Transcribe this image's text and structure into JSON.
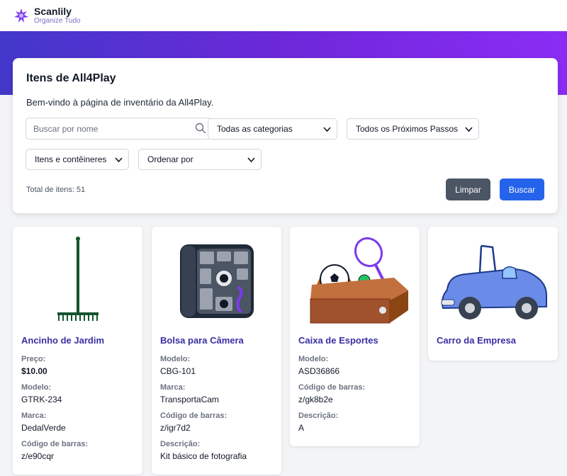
{
  "brand": {
    "name": "Scanlily",
    "tagline": "Organize Tudo"
  },
  "panel": {
    "title": "Itens de All4Play",
    "description": "Bem-vindo à página de inventário da All4Play.",
    "search_placeholder": "Buscar por nome",
    "filters": {
      "category": "Todas as categorias",
      "next_steps": "Todos os Próximos Passos",
      "item_type": "Itens e contêineres",
      "sort": "Ordenar por"
    },
    "total": "Total de itens: 51",
    "clear_label": "Limpar",
    "search_label": "Buscar"
  },
  "items": [
    {
      "title": "Ancinho de Jardim",
      "icon": "rake-icon",
      "fields": [
        {
          "label": "Preço:",
          "value": "$10.00"
        },
        {
          "label": "Modelo:",
          "value": "GTRK-234"
        },
        {
          "label": "Marca:",
          "value": "DedalVerde"
        },
        {
          "label": "Código de barras:",
          "value": "z/e90cqr"
        }
      ]
    },
    {
      "title": "Bolsa para Câmera",
      "icon": "camera-bag-icon",
      "fields": [
        {
          "label": "Modelo:",
          "value": "CBG-101"
        },
        {
          "label": "Marca:",
          "value": "TransportaCam"
        },
        {
          "label": "Código de barras:",
          "value": "z/igr7d2"
        },
        {
          "label": "Descrição:",
          "value": "Kit básico de fotografia"
        }
      ]
    },
    {
      "title": "Caixa de Esportes",
      "icon": "sports-box-icon",
      "fields": [
        {
          "label": "Modelo:",
          "value": "ASD36866"
        },
        {
          "label": "Código de barras:",
          "value": "z/gk8b2e"
        },
        {
          "label": "Descrição:",
          "value": "A"
        }
      ]
    },
    {
      "title": "Carro da Empresa",
      "icon": "car-icon",
      "fields": []
    }
  ],
  "colors": {
    "primary": "#2563eb",
    "secondary": "#4b5563",
    "accent": "#3730a3",
    "hero_start": "#4338ca",
    "hero_end": "#8b2cf5"
  }
}
